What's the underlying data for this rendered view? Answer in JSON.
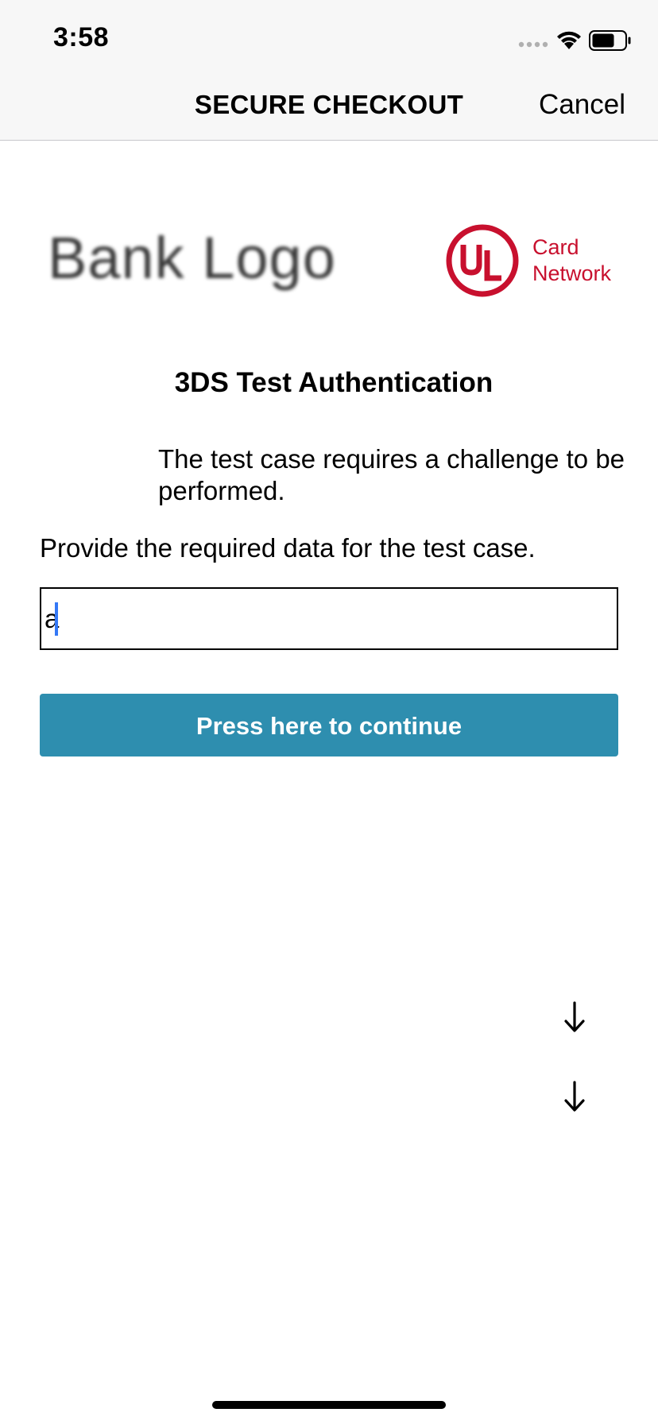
{
  "status_bar": {
    "time": "3:58",
    "icons": [
      "signal-icon",
      "wifi-icon",
      "battery-icon"
    ]
  },
  "nav": {
    "title": "SECURE CHECKOUT",
    "cancel_label": "Cancel"
  },
  "header": {
    "bank_logo_text": "Bank Logo",
    "card_network_text": "Card\nNetwork",
    "card_network_color": "#c8102e"
  },
  "challenge": {
    "title": "3DS Test Authentication",
    "info_text": "The test case requires a challenge to be performed.",
    "input_label": "Provide the required data for the test case.",
    "input_value": "a",
    "button_label": "Press here to continue",
    "button_color": "#2e8eaf"
  },
  "extra_icons": [
    "arrow-down-icon",
    "arrow-down-icon"
  ]
}
